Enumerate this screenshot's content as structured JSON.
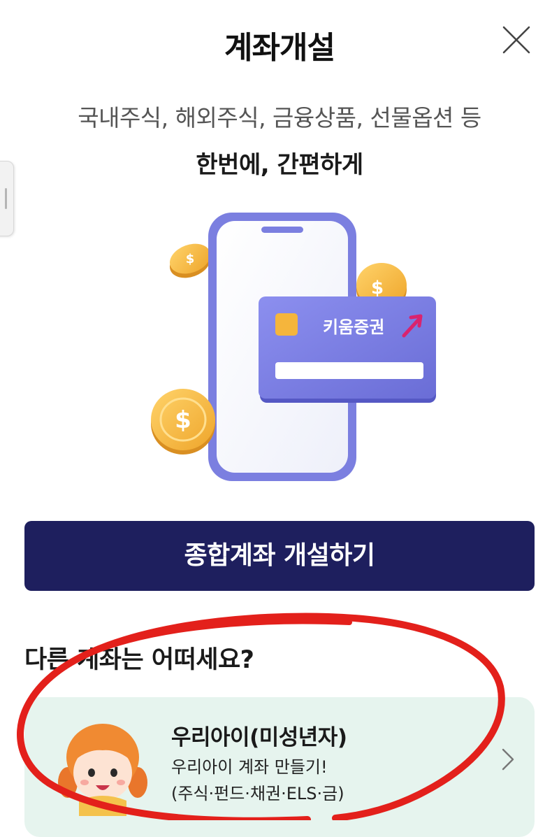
{
  "header": {
    "title": "계좌개설"
  },
  "intro": {
    "line1": "국내주식, 해외주식, 금융상품, 선물옵션 등",
    "line2": "한번에, 간편하게"
  },
  "illustration": {
    "card_brand": "키움증권"
  },
  "primary_button": {
    "label": "종합계좌 개설하기"
  },
  "other_accounts": {
    "heading": "다른 계좌는 어떠세요?",
    "items": [
      {
        "title": "우리아이(미성년자)",
        "desc1": "우리아이 계좌 만들기!",
        "desc2": "(주식·펀드·채권·ELS·금)"
      }
    ]
  },
  "colors": {
    "primary": "#1e1f5e",
    "card_bg": "#e6f4ee",
    "phone_frame": "#7b7fe0",
    "coin": "#f2b13d",
    "annotation_red": "#e3201b"
  }
}
